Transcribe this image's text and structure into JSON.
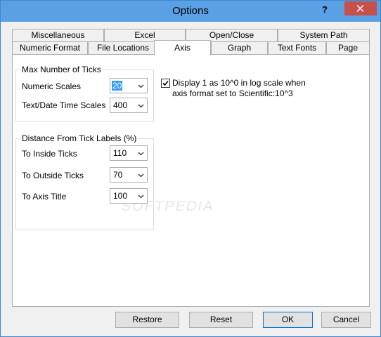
{
  "window": {
    "title": "Options",
    "help_label": "?"
  },
  "tabs": {
    "row_back": [
      {
        "label": "Miscellaneous"
      },
      {
        "label": "Excel"
      },
      {
        "label": "Open/Close"
      },
      {
        "label": "System Path"
      }
    ],
    "row_front": [
      {
        "label": "Numeric Format"
      },
      {
        "label": "File Locations"
      },
      {
        "label": "Axis",
        "active": true
      },
      {
        "label": "Graph"
      },
      {
        "label": "Text Fonts"
      },
      {
        "label": "Page"
      }
    ]
  },
  "max_ticks": {
    "title": "Max Number of Ticks",
    "numeric_label": "Numeric Scales",
    "numeric_value": "20",
    "textdate_label": "Text/Date Time Scales",
    "textdate_value": "400"
  },
  "distance": {
    "title": "Distance From Tick Labels (%)",
    "inside_label": "To Inside Ticks",
    "inside_value": "110",
    "outside_label": "To Outside Ticks",
    "outside_value": "70",
    "axis_title_label": "To Axis Title",
    "axis_title_value": "100"
  },
  "log_option": {
    "checked": true,
    "line1": "Display 1 as 10^0 in log scale when",
    "line2": "axis format set to Scientific:10^3"
  },
  "buttons": {
    "restore": "Restore",
    "reset": "Reset",
    "ok": "OK",
    "cancel": "Cancel"
  },
  "watermark": "SOFTPEDIA"
}
